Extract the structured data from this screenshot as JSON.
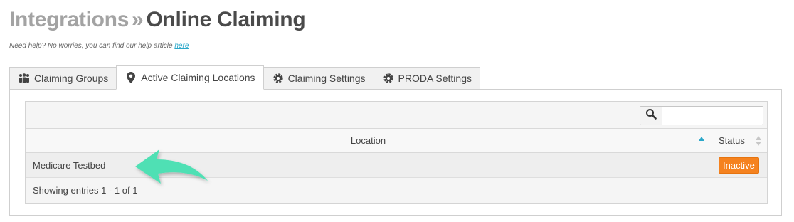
{
  "header": {
    "breadcrumb_parent": "Integrations",
    "separator": "»",
    "page_title": "Online Claiming"
  },
  "help": {
    "text": "Need help? No worries, you can find our help article",
    "link_label": "here"
  },
  "tabs": [
    {
      "label": "Claiming Groups",
      "icon": "users-icon",
      "active": false
    },
    {
      "label": "Active Claiming Locations",
      "icon": "map-marker-icon",
      "active": true
    },
    {
      "label": "Claiming Settings",
      "icon": "gear-icon",
      "active": false
    },
    {
      "label": "PRODA Settings",
      "icon": "gear-icon",
      "active": false
    }
  ],
  "table": {
    "search": {
      "icon": "search-icon",
      "value": "",
      "placeholder": ""
    },
    "columns": [
      {
        "label": "Location",
        "sort": "ascending"
      },
      {
        "label": "Status",
        "sort": "none"
      }
    ],
    "rows": [
      {
        "location": "Medicare Testbed",
        "status": "Inactive"
      }
    ],
    "footer": "Showing entries 1 - 1 of 1"
  },
  "colors": {
    "accent": "#2aa7c9",
    "status_inactive": "#f5821f",
    "annotation_arrow": "#4fe0b4"
  }
}
